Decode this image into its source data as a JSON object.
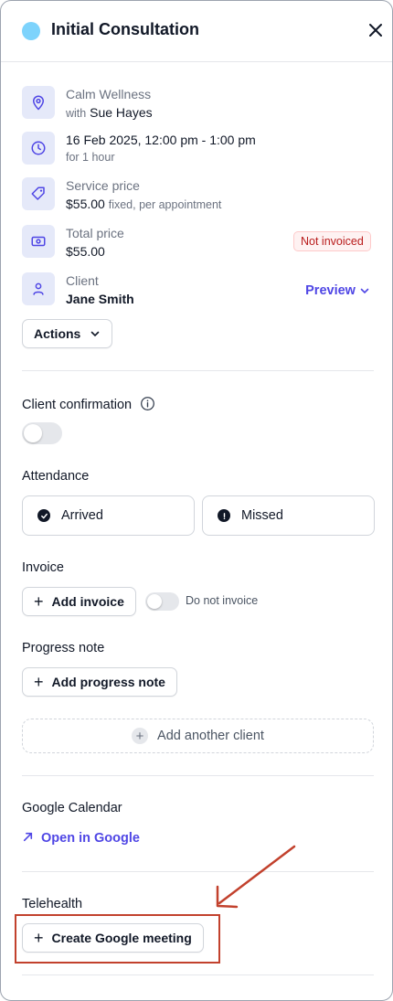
{
  "header": {
    "title": "Initial Consultation",
    "dot_color": "#7dd3fc"
  },
  "location": {
    "name": "Calm Wellness",
    "with_prefix": "with",
    "practitioner": "Sue Hayes"
  },
  "datetime": {
    "when": "16 Feb 2025, 12:00 pm - 1:00 pm",
    "duration": "for 1 hour"
  },
  "service_price": {
    "label": "Service price",
    "amount": "$55.00",
    "note": "fixed, per appointment"
  },
  "total_price": {
    "label": "Total price",
    "amount": "$55.00",
    "badge": "Not invoiced"
  },
  "client": {
    "label": "Client",
    "name": "Jane Smith",
    "preview": "Preview"
  },
  "actions": {
    "label": "Actions"
  },
  "confirmation": {
    "label": "Client confirmation",
    "enabled": false
  },
  "attendance": {
    "label": "Attendance",
    "arrived": "Arrived",
    "missed": "Missed"
  },
  "invoice": {
    "label": "Invoice",
    "add_label": "Add invoice",
    "do_not_invoice": "Do not invoice",
    "do_not_invoice_enabled": false
  },
  "progress_note": {
    "label": "Progress note",
    "add_label": "Add progress note"
  },
  "add_client": {
    "label": "Add another client"
  },
  "google_calendar": {
    "label": "Google Calendar",
    "link": "Open in Google"
  },
  "telehealth": {
    "label": "Telehealth",
    "create_label": "Create Google meeting"
  },
  "colors": {
    "accent": "#4f46e5",
    "icon_bg": "#e5e9f9",
    "annotation": "#c2412d",
    "badge_text": "#b91c1c"
  }
}
